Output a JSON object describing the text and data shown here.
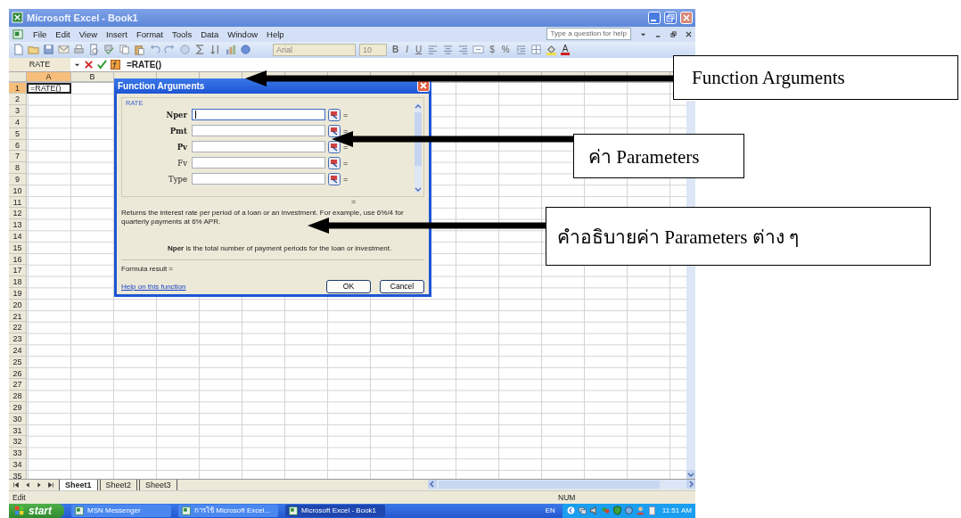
{
  "window": {
    "title": "Microsoft Excel - Book1"
  },
  "menu": [
    "File",
    "Edit",
    "View",
    "Insert",
    "Format",
    "Tools",
    "Data",
    "Window",
    "Help"
  ],
  "help_box": {
    "placeholder": "Type a question for help"
  },
  "toolbar": {
    "font": "Arial",
    "size": "10",
    "format_buttons": [
      "B",
      "I",
      "U"
    ],
    "number_buttons": [
      "$",
      "%"
    ],
    "font_color_button": "A"
  },
  "formula_bar": {
    "name_box": "RATE",
    "formula": "=RATE()"
  },
  "columns": [
    {
      "label": "A",
      "selected": true
    },
    {
      "label": "B",
      "selected": false
    }
  ],
  "rows": [
    {
      "label": "1",
      "selected": true,
      "cells": [
        "=RATE()"
      ]
    },
    {
      "label": "2",
      "selected": false
    },
    {
      "label": "3",
      "selected": false
    },
    {
      "label": "4",
      "selected": false
    },
    {
      "label": "5",
      "selected": false
    },
    {
      "label": "6",
      "selected": false
    },
    {
      "label": "7",
      "selected": false
    },
    {
      "label": "8",
      "selected": false
    },
    {
      "label": "9",
      "selected": false
    },
    {
      "label": "10",
      "selected": false
    },
    {
      "label": "11",
      "selected": false
    },
    {
      "label": "12",
      "selected": false
    },
    {
      "label": "13",
      "selected": false
    },
    {
      "label": "14",
      "selected": false
    },
    {
      "label": "15",
      "selected": false
    },
    {
      "label": "16",
      "selected": false
    },
    {
      "label": "17",
      "selected": false
    },
    {
      "label": "18",
      "selected": false
    },
    {
      "label": "19",
      "selected": false
    },
    {
      "label": "20",
      "selected": false
    },
    {
      "label": "21",
      "selected": false
    },
    {
      "label": "22",
      "selected": false
    },
    {
      "label": "23",
      "selected": false
    },
    {
      "label": "24",
      "selected": false
    },
    {
      "label": "25",
      "selected": false
    },
    {
      "label": "26",
      "selected": false
    },
    {
      "label": "27",
      "selected": false
    },
    {
      "label": "28",
      "selected": false
    },
    {
      "label": "29",
      "selected": false
    },
    {
      "label": "30",
      "selected": false
    },
    {
      "label": "31",
      "selected": false
    },
    {
      "label": "32",
      "selected": false
    },
    {
      "label": "33",
      "selected": false
    },
    {
      "label": "34",
      "selected": false
    },
    {
      "label": "35",
      "selected": false
    }
  ],
  "dialog": {
    "title": "Function Arguments",
    "function": "RATE",
    "arguments": [
      {
        "label": "Nper",
        "required": true,
        "focused": true,
        "equals": "="
      },
      {
        "label": "Pmt",
        "required": true,
        "focused": false,
        "equals": "="
      },
      {
        "label": "Pv",
        "required": true,
        "focused": false,
        "equals": "="
      },
      {
        "label": "Fv",
        "required": false,
        "focused": false,
        "equals": "="
      },
      {
        "label": "Type",
        "required": false,
        "focused": false,
        "equals": "="
      }
    ],
    "result_equals": "=",
    "description": "Returns the interest rate per period of a loan or an investment. For example, use 6%/4 for quarterly payments at 6% APR.",
    "argument_help": "**Nper** is the total number of payment periods for the loan or investment.",
    "formula_result": "Formula result =",
    "help_link": "Help on this function",
    "buttons": [
      "OK",
      "Cancel"
    ]
  },
  "sheet_tabs": [
    {
      "label": "Sheet1",
      "selected": true
    },
    {
      "label": "Sheet2",
      "selected": false
    },
    {
      "label": "Sheet3",
      "selected": false
    }
  ],
  "status_bar": {
    "mode": "Edit",
    "indicator": "NUM"
  },
  "taskbar": {
    "start": "start",
    "tasks": [
      {
        "label": "MSN Messenger",
        "selected": false
      },
      {
        "label": "การใช้ Microsoft Excel...",
        "selected": false
      },
      {
        "label": "Microsoft Excel - Book1",
        "selected": true
      }
    ],
    "language": "EN",
    "clock": "11:51 AM"
  },
  "annotations": [
    {
      "text": "Function Arguments"
    },
    {
      "text": "ค่า Parameters"
    },
    {
      "text": "คำอธิบายค่า Parameters ต่าง ๆ"
    }
  ]
}
